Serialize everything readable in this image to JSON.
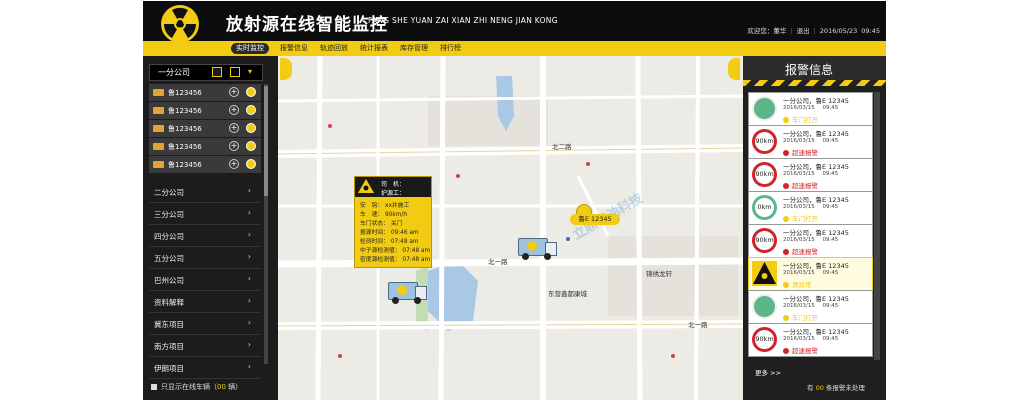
{
  "header": {
    "title": "放射源在线智能监控",
    "pinyin": "FANG SHE YUAN ZAI XIAN ZHI NENG JIAN KONG",
    "welcome": "欢迎您：董华",
    "logout": "退出",
    "date": "2016/05/23",
    "time": "09:45"
  },
  "nav": [
    "实时监控",
    "报警信息",
    "轨迹回放",
    "统计报表",
    "库存管理",
    "排行榜"
  ],
  "sidebar": {
    "company": "一分公司",
    "vehicles": [
      "鲁123456",
      "鲁123456",
      "鲁123456",
      "鲁123456",
      "鲁123456"
    ],
    "groups": [
      "二分公司",
      "三分公司",
      "四分公司",
      "五分公司",
      "巴州公司",
      "资料解释",
      "冀东项目",
      "南方项目",
      "伊朗项目"
    ],
    "online_prefix": "只显示在线车辆（",
    "online_count": "00",
    "online_suffix": " 辆）"
  },
  "map": {
    "infowin": {
      "driver": "司　机：",
      "guard": "护源工：",
      "rows": [
        "安　钩：  xx井施工",
        "车　速：  90km/h",
        "车门状态：  关门",
        "报源时间：  09:46 am",
        "检测时间：  07:48 am",
        "中子源检测值：  07:48 am",
        "密度源检测值：  07:48 am"
      ]
    },
    "marker_plate": "鲁E 12345",
    "labels": {
      "road_north": "北二路",
      "road_mid": "北一路",
      "xiaoqu": "东营鑫都康城",
      "jinxiu": "锦绣龙轩",
      "lixin": "立鼎石油科技"
    }
  },
  "alarm_panel": {
    "title": "报警信息",
    "items": [
      {
        "company": "一分公司，鲁E 12345",
        "date": "2016/03/15",
        "time": "09:45",
        "status": "车门打开",
        "icon": "door",
        "status_color": "#f2cc12"
      },
      {
        "company": "一分公司，鲁E 12345",
        "date": "2016/03/15",
        "time": "09:45",
        "status": "超速报警",
        "icon": "speed",
        "icon_text": "90km",
        "status_color": "#d2232a"
      },
      {
        "company": "一分公司，鲁E 12345",
        "date": "2016/03/15",
        "time": "09:45",
        "status": "超速报警",
        "icon": "speed",
        "icon_text": "90km",
        "status_color": "#d2232a"
      },
      {
        "company": "一分公司，鲁E 12345",
        "date": "2016/03/15",
        "time": "09:45",
        "status": "车门打开",
        "icon": "zero",
        "icon_text": "0km",
        "status_color": "#f2cc12"
      },
      {
        "company": "一分公司，鲁E 12345",
        "date": "2016/03/15",
        "time": "09:45",
        "status": "超速报警",
        "icon": "speed",
        "icon_text": "90km",
        "status_color": "#d2232a"
      },
      {
        "company": "一分公司，鲁E 12345",
        "date": "2016/03/15",
        "time": "09:45",
        "status": "源异常",
        "icon": "rad",
        "status_color": "#f2cc12"
      },
      {
        "company": "一分公司，鲁E 12345",
        "date": "2016/03/15",
        "time": "09:45",
        "status": "车门打开",
        "icon": "door",
        "status_color": "#f2cc12"
      },
      {
        "company": "一分公司，鲁E 12345",
        "date": "2016/03/15",
        "time": "09:45",
        "status": "超速报警",
        "icon": "speed",
        "icon_text": "90km",
        "status_color": "#d2232a"
      }
    ],
    "more": "更多 >>",
    "pending_prefix": "有 ",
    "pending_count": "00",
    "pending_suffix": " 条报警未处理"
  },
  "colors": {
    "accent": "#f2cc12",
    "dark": "#1c1c1c",
    "alarm_red": "#d2232a",
    "door_green": "#5fb58a"
  }
}
